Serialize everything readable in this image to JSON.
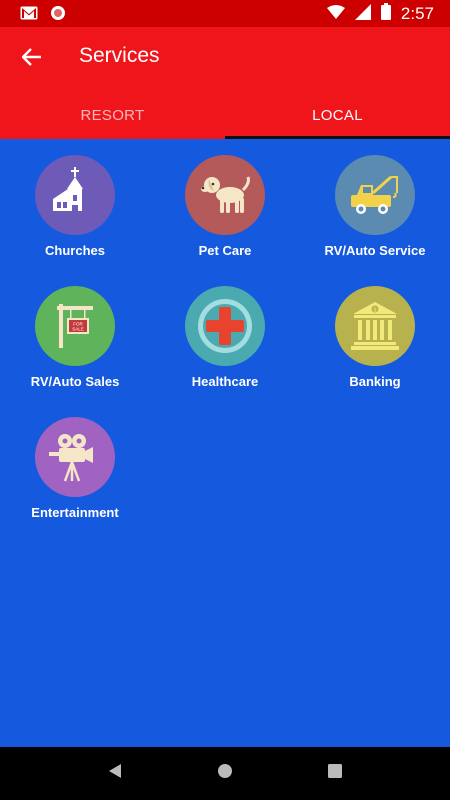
{
  "status_bar": {
    "time": "2:57",
    "icons": [
      "gmail-icon",
      "circle-notification-icon",
      "wifi-icon",
      "signal-icon",
      "battery-icon"
    ]
  },
  "app_bar": {
    "title": "Services",
    "back_icon": "arrow-back-icon",
    "background_color": "#f0151a",
    "tabs": [
      {
        "label": "RESORT",
        "active": false
      },
      {
        "label": "LOCAL",
        "active": true
      }
    ]
  },
  "services": [
    {
      "label": "Churches",
      "icon": "church-icon",
      "color": "#6e5bb8"
    },
    {
      "label": "Pet Care",
      "icon": "dog-icon",
      "color": "#b55a5a"
    },
    {
      "label": "RV/Auto Service",
      "icon": "tow-truck-icon",
      "color": "#5b8bb0"
    },
    {
      "label": "RV/Auto Sales",
      "icon": "for-sale-sign-icon",
      "color": "#5fb35a"
    },
    {
      "label": "Healthcare",
      "icon": "medical-cross-icon",
      "color": "#4aaab0"
    },
    {
      "label": "Banking",
      "icon": "bank-icon",
      "color": "#b7b24e"
    },
    {
      "label": "Entertainment",
      "icon": "movie-camera-icon",
      "color": "#a063c2"
    }
  ],
  "page_background": "#1559df",
  "nav_bar": {
    "buttons": [
      "back-triangle-icon",
      "home-circle-icon",
      "recents-square-icon"
    ]
  }
}
